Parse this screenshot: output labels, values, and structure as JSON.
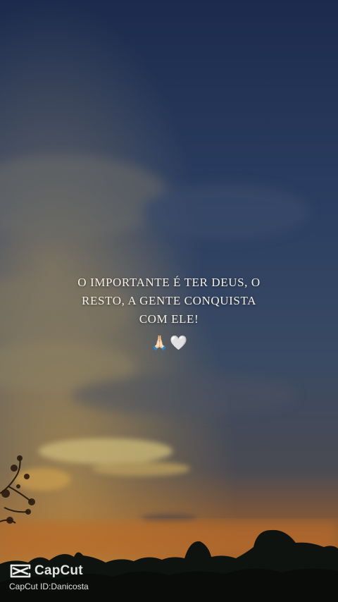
{
  "quote": {
    "lines": [
      "O IMPORTANTE É TER DEUS, O",
      "RESTO, A GENTE CONQUISTA",
      "COM ELE!"
    ],
    "emoji_pray": "🙏🏻",
    "emoji_heart": "🤍"
  },
  "watermark": {
    "brand": "CapCut",
    "id_line": "CapCut ID:Danicosta"
  },
  "colors": {
    "sky_top": "#1f2f52",
    "sky_mid": "#2f4466",
    "horizon_glow": "#b86b2a",
    "text": "#f5efe3"
  }
}
